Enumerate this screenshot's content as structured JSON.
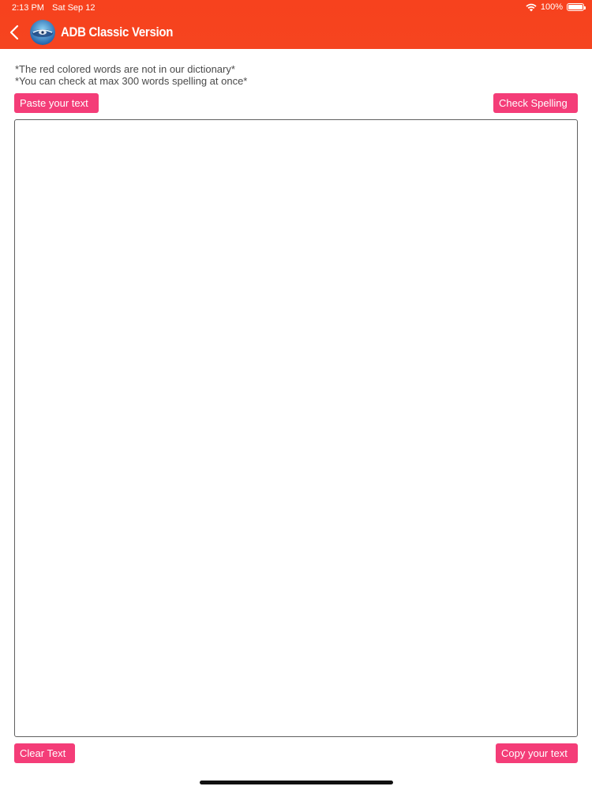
{
  "status_bar": {
    "time": "2:13 PM",
    "date": "Sat Sep 12",
    "battery": "100%",
    "icons": [
      "wifi-icon",
      "battery-icon"
    ]
  },
  "nav": {
    "title": "ADB Classic Version",
    "back_icon": "chevron-left-icon",
    "logo_icon": "app-logo-icon"
  },
  "notes": {
    "line1": "*The red colored words are not in our dictionary*",
    "line2": "*You can check at max 300 words spelling at once*"
  },
  "buttons": {
    "paste": "Paste your text",
    "check": "Check Spelling",
    "clear": "Clear Text",
    "copy": "Copy your text"
  },
  "editor": {
    "value": "",
    "placeholder": ""
  },
  "colors": {
    "header": "#f5441f",
    "button": "#f43d78",
    "text": "#4a4a4a"
  }
}
